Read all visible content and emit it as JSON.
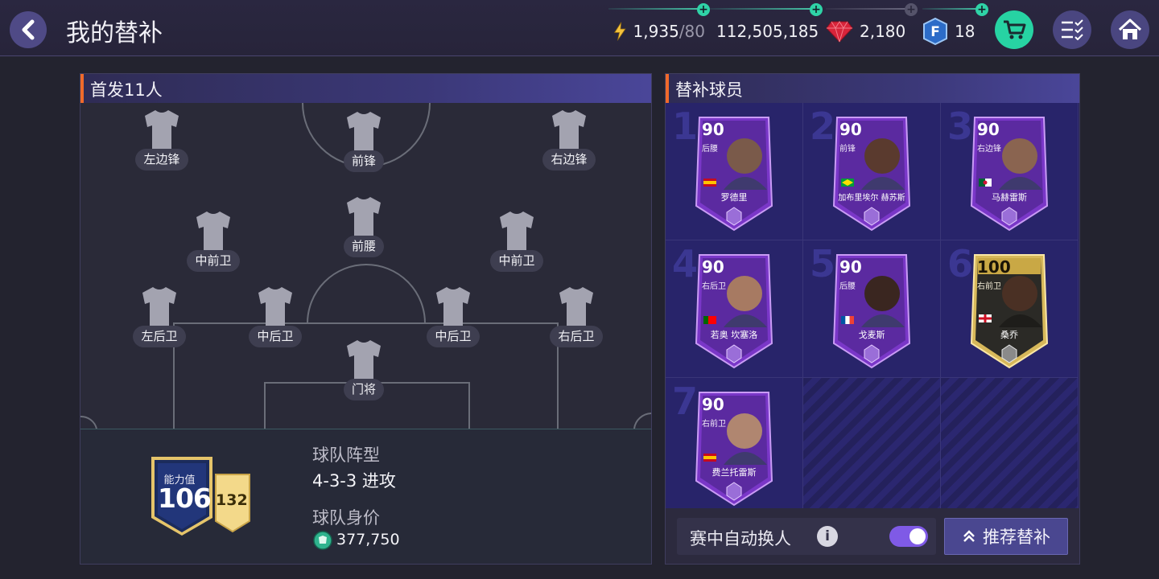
{
  "header": {
    "title": "我的替补",
    "energy": {
      "value": "1,935",
      "max": "/80"
    },
    "coins": "112,505,185",
    "gems": "2,180",
    "fifa_points": "18"
  },
  "lineup": {
    "title": "首发11人",
    "positions": [
      {
        "label": "左边锋"
      },
      {
        "label": "前锋"
      },
      {
        "label": "右边锋"
      },
      {
        "label": "中前卫"
      },
      {
        "label": "前腰"
      },
      {
        "label": "中前卫"
      },
      {
        "label": "左后卫"
      },
      {
        "label": "中后卫"
      },
      {
        "label": "中后卫"
      },
      {
        "label": "右后卫"
      },
      {
        "label": "门将"
      }
    ]
  },
  "team_info": {
    "rating_caption": "能力值",
    "rating": "106",
    "secondary_rating": "132",
    "formation_label": "球队阵型",
    "formation": "4-3-3 进攻",
    "value_label": "球队身价",
    "value": "377,750"
  },
  "subs": {
    "title": "替补球员",
    "players": [
      {
        "slot": "1",
        "rating": "90",
        "position": "后腰",
        "name": "罗德里",
        "tier": "purple",
        "flag_colors": [
          "#c60b1e",
          "#ffc400"
        ]
      },
      {
        "slot": "2",
        "rating": "90",
        "position": "前锋",
        "name": "加布里埃尔 赫苏斯",
        "tier": "purple",
        "flag_colors": [
          "#009c3b",
          "#ffdf00"
        ]
      },
      {
        "slot": "3",
        "rating": "90",
        "position": "右边锋",
        "name": "马赫雷斯",
        "tier": "purple",
        "flag_colors": [
          "#006233",
          "#ffffff"
        ]
      },
      {
        "slot": "4",
        "rating": "90",
        "position": "右后卫",
        "name": "若奥 坎塞洛",
        "tier": "purple",
        "flag_colors": [
          "#006600",
          "#ff0000"
        ]
      },
      {
        "slot": "5",
        "rating": "90",
        "position": "后腰",
        "name": "戈麦斯",
        "tier": "purple",
        "flag_colors": [
          "#0055a4",
          "#ef4135"
        ]
      },
      {
        "slot": "6",
        "rating": "100",
        "position": "右前卫",
        "name": "桑乔",
        "tier": "gold",
        "flag_colors": [
          "#ffffff",
          "#ce1124"
        ]
      },
      {
        "slot": "7",
        "rating": "90",
        "position": "右前卫",
        "name": "费兰托雷斯",
        "tier": "purple",
        "flag_colors": [
          "#c60b1e",
          "#ffc400"
        ]
      }
    ],
    "auto_sub_label": "赛中自动换人",
    "auto_sub_enabled": true,
    "recommend_label": "推荐替补"
  }
}
